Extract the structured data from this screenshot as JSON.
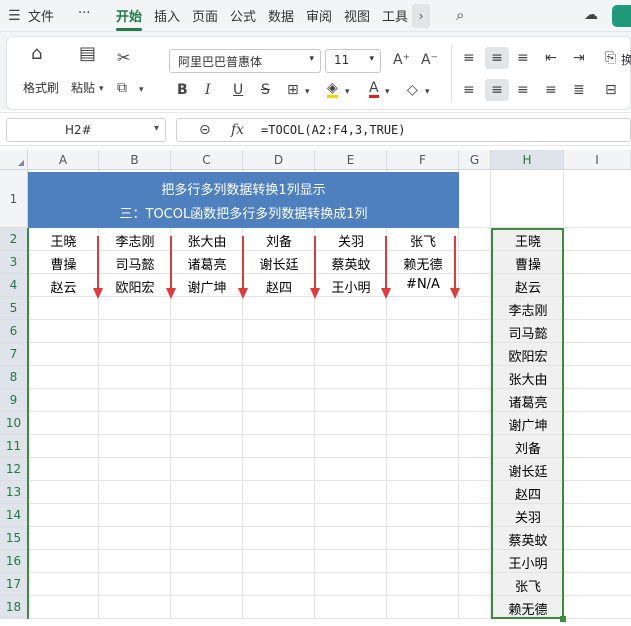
{
  "menu": {
    "file": "文件",
    "more": "···",
    "tabs": [
      "开始",
      "插入",
      "页面",
      "公式",
      "数据",
      "审阅",
      "视图",
      "工具"
    ],
    "active_tab": "开始",
    "accent": "#1f7a44"
  },
  "ribbon": {
    "format_painter": "格式刷",
    "paste": "粘贴",
    "font_name": "阿里巴巴普惠体",
    "font_size": "11",
    "bold": "B",
    "italic": "I",
    "underline": "U",
    "strike": "S",
    "grow_font": "A⁺",
    "shrink_font": "A⁻",
    "font_color_char": "A",
    "partial_label": "换"
  },
  "formula_bar": {
    "name_box": "H2#",
    "fx_label": "fx",
    "formula": "=TOCOL(A2:F4,3,TRUE)"
  },
  "columns": [
    "A",
    "B",
    "C",
    "D",
    "E",
    "F",
    "G",
    "H",
    "I"
  ],
  "selected_column": "H",
  "rows": [
    "1",
    "2",
    "3",
    "4",
    "5",
    "6",
    "7",
    "8",
    "9",
    "10",
    "11",
    "12",
    "13",
    "14",
    "15",
    "16",
    "17",
    "18"
  ],
  "title": {
    "line1": "把多行多列数据转换1列显示",
    "line2": "三：TOCOL函数把多行多列数据转换成1列",
    "bg_color": "#4e80bf"
  },
  "table": [
    [
      "王晓",
      "李志刚",
      "张大由",
      "刘备",
      "关羽",
      "张飞"
    ],
    [
      "曹操",
      "司马懿",
      "诸葛亮",
      "谢长廷",
      "蔡英蚊",
      "赖无德"
    ],
    [
      "赵云",
      "欧阳宏",
      "谢广坤",
      "赵四",
      "王小明",
      "#N/A"
    ]
  ],
  "result_column": [
    "王晓",
    "曹操",
    "赵云",
    "李志刚",
    "司马懿",
    "欧阳宏",
    "张大由",
    "诸葛亮",
    "谢广坤",
    "刘备",
    "谢长廷",
    "赵四",
    "关羽",
    "蔡英蚊",
    "王小明",
    "张飞",
    "赖无德"
  ],
  "arrow_color": "#e03b3b",
  "selection_color": "#3f8a3f"
}
